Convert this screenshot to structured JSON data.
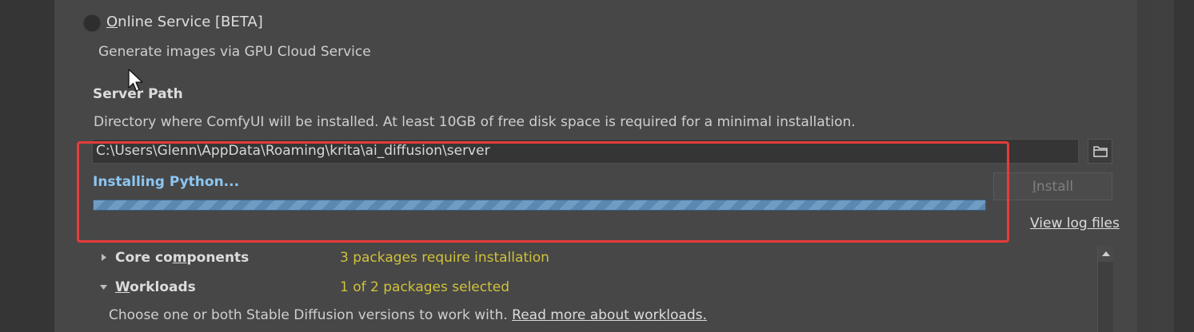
{
  "online_service": {
    "label_prefix": "",
    "label_underlined": "O",
    "label_rest": "nline Service [BETA]",
    "description": "Generate images via GPU Cloud Service"
  },
  "server_path": {
    "title": "Server Path",
    "description": "Directory where ComfyUI will be installed. At least 10GB of free disk space is required for a minimal installation.",
    "value": "C:\\Users\\Glenn\\AppData\\Roaming\\krita\\ai_diffusion\\server"
  },
  "install": {
    "status_text": "Installing Python...",
    "progress_fraction": 1.0,
    "button_underlined": "I",
    "button_rest": "nstall",
    "log_link": "View log files"
  },
  "tree": {
    "core": {
      "label_a": "Core co",
      "label_u": "m",
      "label_b": "ponents",
      "status": "3 packages require installation"
    },
    "workloads": {
      "label_u": "W",
      "label_b": "orkloads",
      "status": "1 of 2 packages selected",
      "description": "Choose one or both Stable Diffusion versions to work with. ",
      "link": "Read more about workloads."
    }
  },
  "colors": {
    "highlight": "#e63b3b",
    "status_blue": "#8cc6f2",
    "status_yellow": "#d0c23a"
  },
  "icons": {
    "radio": "radio-button-icon",
    "folder": "folder-icon",
    "cursor": "mouse-cursor-icon",
    "expand": "chevron-right-icon",
    "collapse": "chevron-down-icon",
    "scroll_up": "scroll-up-arrow-icon"
  }
}
